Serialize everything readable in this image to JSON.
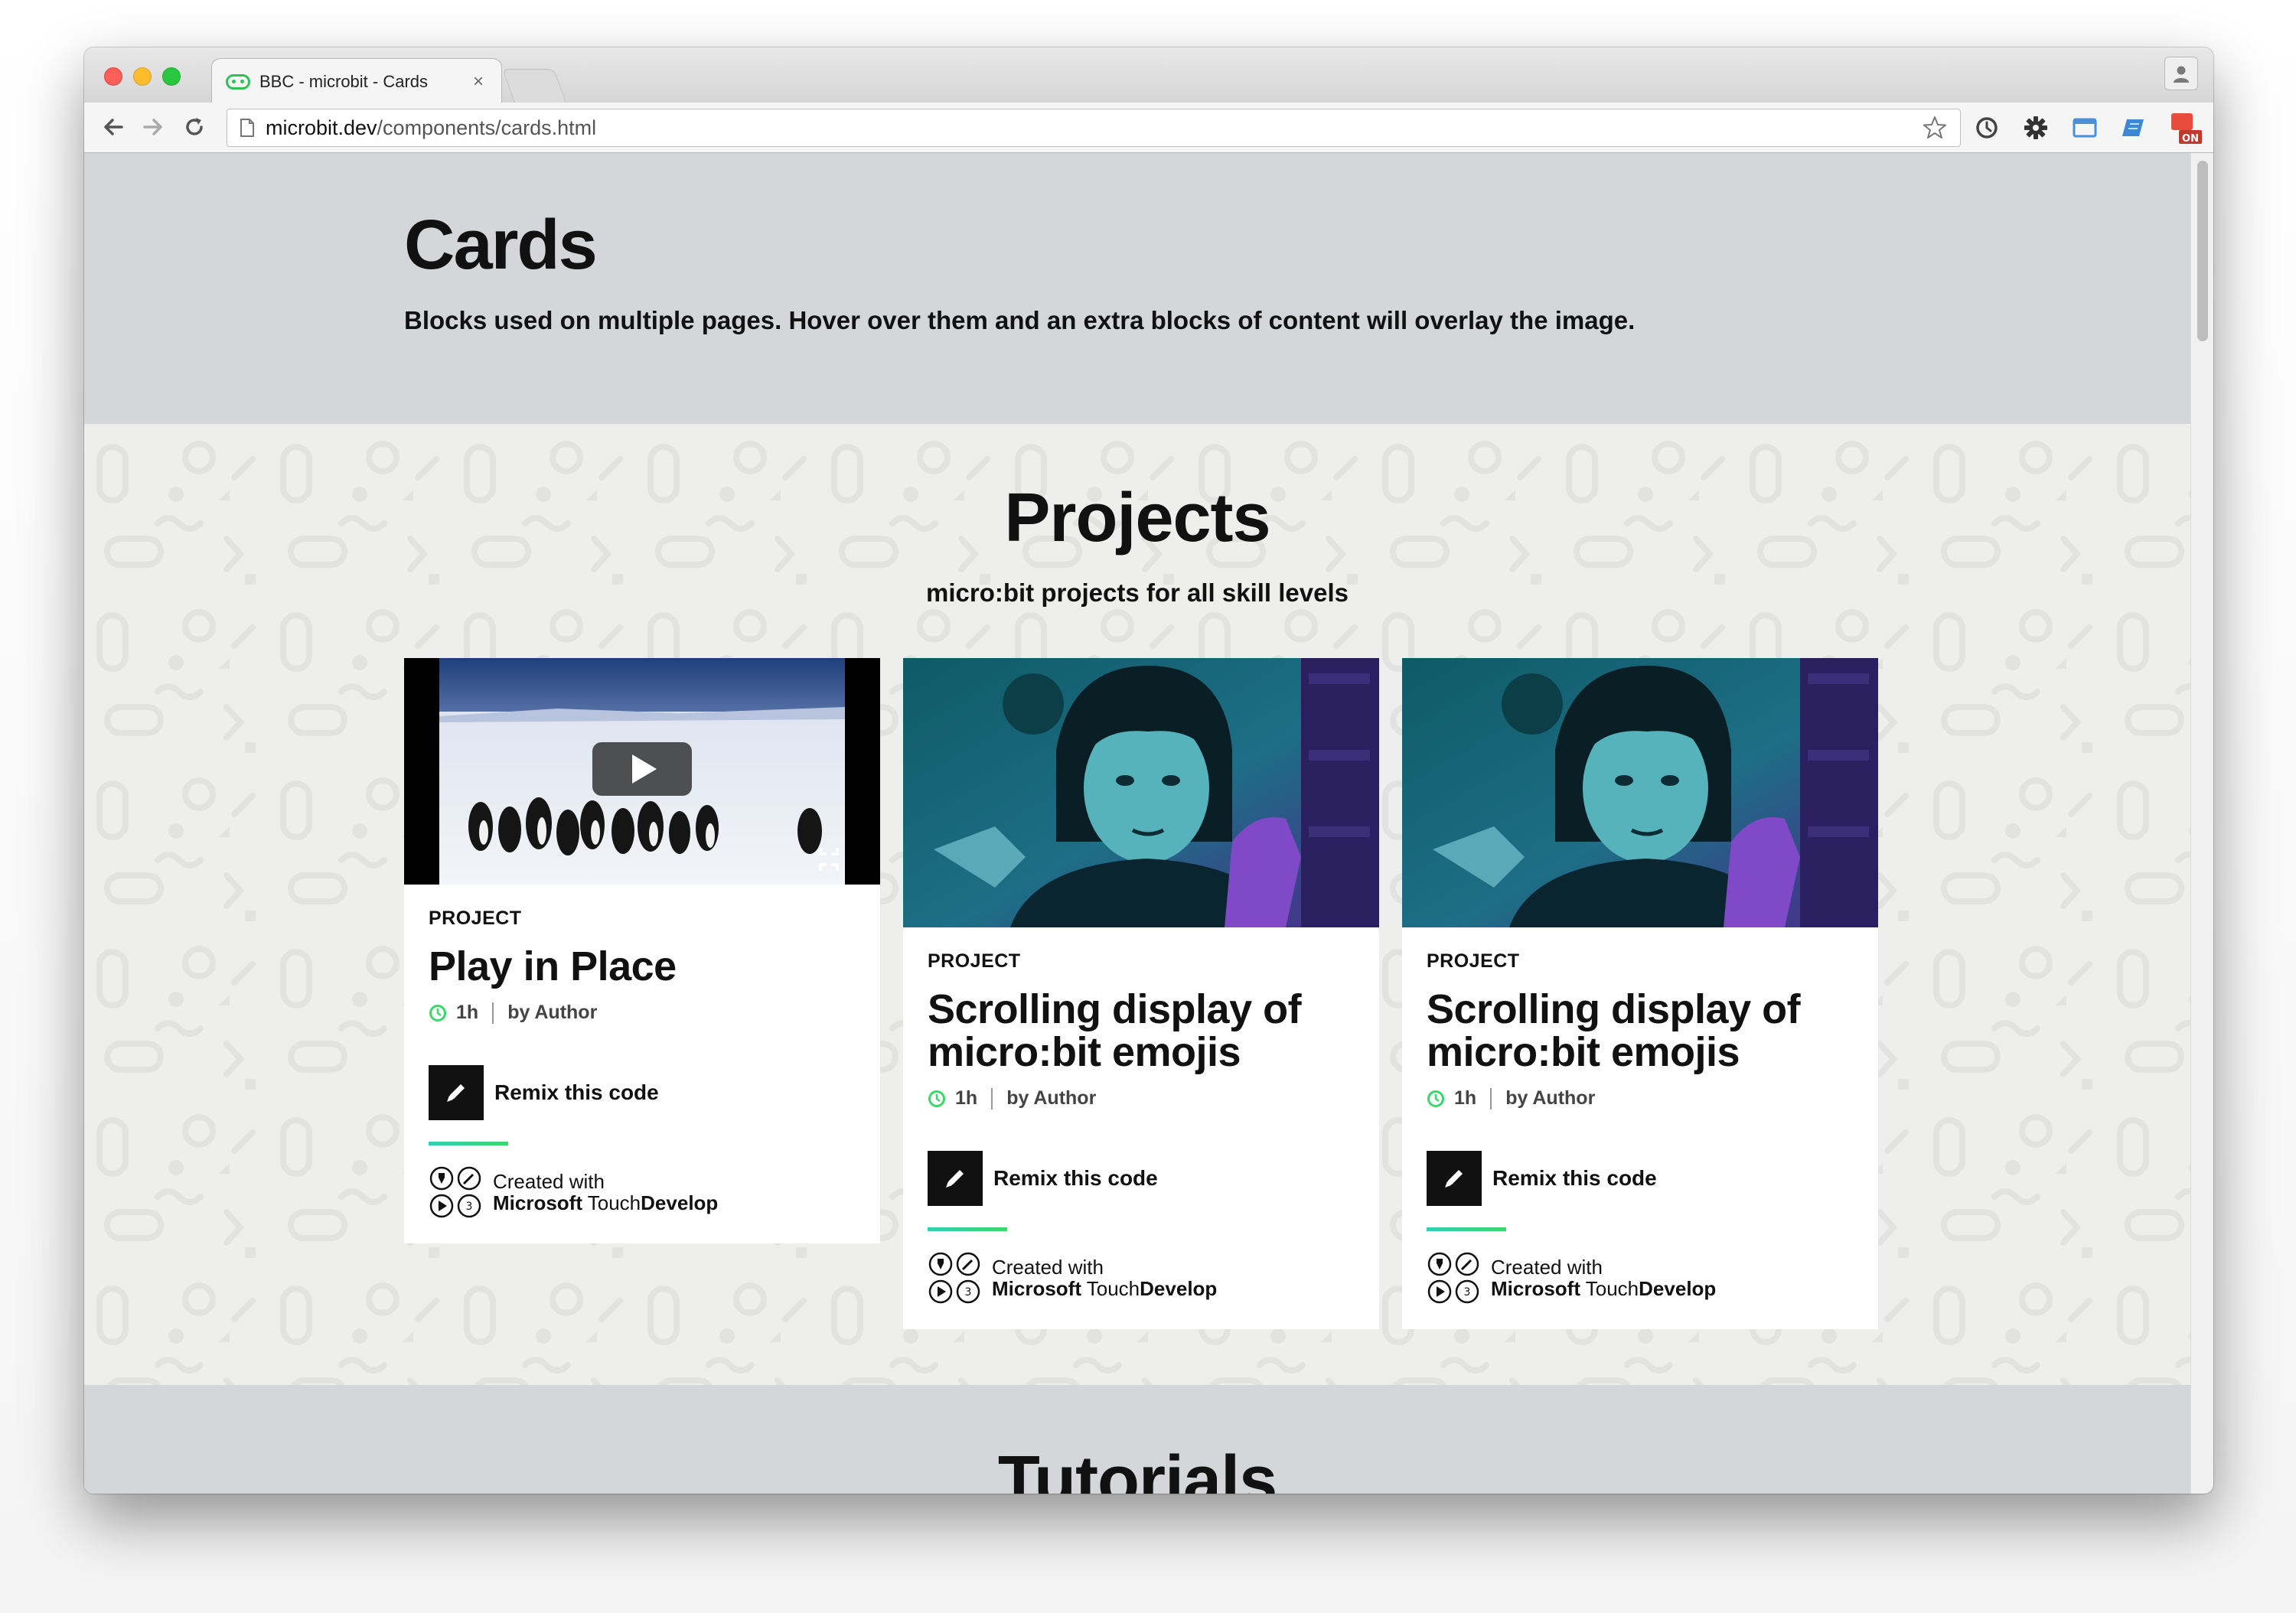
{
  "browser": {
    "tab_title": "BBC - microbit - Cards",
    "tab_close": "×",
    "url_host": "microbit.dev",
    "url_path": "/components/cards.html"
  },
  "hero": {
    "title": "Cards",
    "subtitle": "Blocks used on multiple pages. Hover over them and an extra blocks of content will overlay the image."
  },
  "projects": {
    "title": "Projects",
    "subtitle": "micro:bit projects for all skill levels",
    "cards": [
      {
        "kicker": "PROJECT",
        "title": "Play in Place",
        "duration": "1h",
        "author": "by Author",
        "remix_label": "Remix this code",
        "created_with": "Created with",
        "brand_a": "Microsoft",
        "brand_b": "Touch",
        "brand_c": "Develop"
      },
      {
        "kicker": "PROJECT",
        "title": "Scrolling display of micro:bit emojis",
        "duration": "1h",
        "author": "by Author",
        "remix_label": "Remix this code",
        "created_with": "Created with",
        "brand_a": "Microsoft",
        "brand_b": "Touch",
        "brand_c": "Develop"
      },
      {
        "kicker": "PROJECT",
        "title": "Scrolling display of micro:bit emojis",
        "duration": "1h",
        "author": "by Author",
        "remix_label": "Remix this code",
        "created_with": "Created with",
        "brand_a": "Microsoft",
        "brand_b": "Touch",
        "brand_c": "Develop"
      }
    ]
  },
  "tutorials": {
    "title": "Tutorials"
  },
  "colors": {
    "hero_bg": "#d4d6d9",
    "section_bg": "#eeeeec",
    "accent_green": "#3ad867",
    "accent_teal": "#2fd1b4",
    "ink": "#111111"
  },
  "icons": {
    "toolbar": [
      "back-arrow-icon",
      "forward-arrow-icon",
      "reload-icon",
      "page-icon",
      "star-icon",
      "sync-icon",
      "gear-icon",
      "window-icon",
      "bookmark-icon",
      "extension-on-icon",
      "cast-icon",
      "menu-icon"
    ],
    "card": [
      "play-icon",
      "fullscreen-icon",
      "clock-icon",
      "pencil-icon",
      "touchdevelop-logo-icon"
    ]
  }
}
